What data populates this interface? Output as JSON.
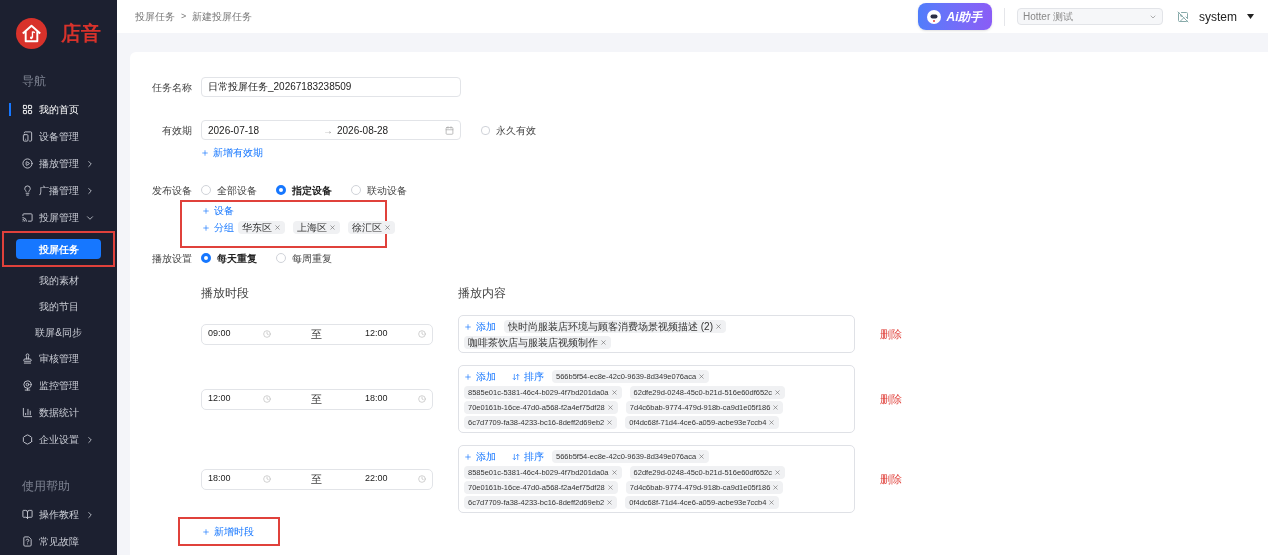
{
  "logo": {
    "text": "店音"
  },
  "sidebar": {
    "sections": [
      {
        "title": "导航",
        "items": [
          {
            "label": "我的首页",
            "selected": true
          },
          {
            "label": "设备管理",
            "selected": false
          },
          {
            "label": "播放管理",
            "selected": false,
            "expanded": false
          },
          {
            "label": "广播管理",
            "selected": false,
            "expanded": false
          },
          {
            "label": "投屏管理",
            "selected": false,
            "expanded": true,
            "children": [
              {
                "label": "投屏任务",
                "selected": true,
                "highlighted": true
              },
              {
                "label": "我的素材",
                "selected": false,
                "highlighted": false
              },
              {
                "label": "我的节目",
                "selected": false,
                "highlighted": false
              },
              {
                "label": "联屏&同步",
                "selected": false,
                "highlighted": false
              }
            ]
          },
          {
            "label": "审核管理",
            "selected": false
          },
          {
            "label": "监控管理",
            "selected": false
          },
          {
            "label": "数据统计",
            "selected": false
          },
          {
            "label": "企业设置",
            "selected": false,
            "expanded": false
          }
        ]
      },
      {
        "title": "使用帮助",
        "items": [
          {
            "label": "操作教程",
            "selected": false,
            "expanded": false
          },
          {
            "label": "常见故障",
            "selected": false
          }
        ]
      }
    ]
  },
  "header": {
    "breadcrumb": [
      "投屏任务",
      "新建投屏任务"
    ],
    "breadcrumb_separator": ">",
    "ai_button": "Ai助手",
    "store_select": "Hotter 测试",
    "user": "system"
  },
  "form": {
    "task_name": {
      "label": "任务名称",
      "value": "日常投屏任务_20267183238509"
    },
    "validity": {
      "label": "有效期",
      "start": "2026-07-18",
      "separator": "→",
      "end": "2026-08-28",
      "permanent": {
        "label": "永久有效",
        "checked": false
      },
      "add_link": "新增有效期"
    },
    "publish": {
      "label": "发布设备",
      "options": [
        {
          "label": "全部设备",
          "selected": false
        },
        {
          "label": "指定设备",
          "selected": true
        },
        {
          "label": "联动设备",
          "selected": false
        }
      ],
      "highlighted": true,
      "targets": [
        {
          "label": "设备"
        },
        {
          "label": "分组",
          "tags": [
            "华东区",
            "上海区",
            "徐汇区"
          ]
        }
      ]
    },
    "repeat": {
      "label": "播放设置",
      "options": [
        {
          "label": "每天重复",
          "selected": true
        },
        {
          "label": "每周重复",
          "selected": false
        }
      ]
    },
    "schedule": {
      "time_heading": "播放时段",
      "content_heading": "播放内容",
      "rows": [
        {
          "start": "09:00",
          "to": "至",
          "end": "12:00",
          "add_label": "添加",
          "tags": [
            "快时尚服装店环境与顾客消费场景视频描述 (2)",
            "咖啡茶饮店与服装店视频制作"
          ],
          "delete_label": "删除"
        },
        {
          "start": "12:00",
          "to": "至",
          "end": "18:00",
          "add_label": "添加",
          "sort_label": "排序",
          "tags": [
            "566b5f54-ec8e-42c0-9639-8d349e076aca",
            "8585e01c-5381-46c4-b029-4f7bd201da0a",
            "62dfe29d-0248-45c0-b21d-516e60df652c",
            "70e0161b-16ce-47d0-a568-f2a4ef75df28",
            "7d4c6bab-9774-479d-918b-ca9d1e05f186",
            "6c7d7709-fa38-4233-bc16-8deff2d69eb2",
            "0f4dc68f-71d4-4ce6-a059-acbe93e7ccb4"
          ],
          "delete_label": "删除"
        },
        {
          "start": "18:00",
          "to": "至",
          "end": "22:00",
          "add_label": "添加",
          "sort_label": "排序",
          "tags": [
            "566b5f54-ec8e-42c0-9639-8d349e076aca",
            "8585e01c-5381-46c4-b029-4f7bd201da0a",
            "62dfe29d-0248-45c0-b21d-516e60df652c",
            "70e0161b-16ce-47d0-a568-f2a4ef75df28",
            "7d4c6bab-9774-479d-918b-ca9d1e05f186",
            "6c7d7709-fa38-4233-bc16-8deff2d69eb2",
            "0f4dc68f-71d4-4ce6-a059-acbe93e7ccb4"
          ],
          "delete_label": "删除"
        }
      ]
    },
    "add_period": {
      "label": "新增时段",
      "highlighted": true
    }
  }
}
